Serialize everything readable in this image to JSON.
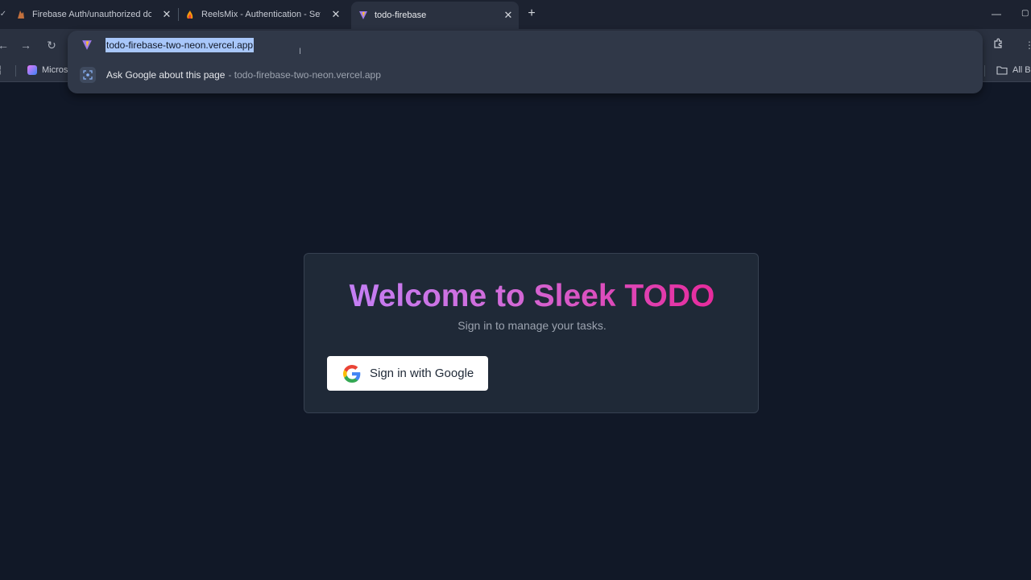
{
  "tabs": [
    {
      "title": "Firebase Auth/unauthorized do",
      "icon": "firebase-icon",
      "active": false
    },
    {
      "title": "ReelsMix - Authentication - Set",
      "icon": "firebase-icon",
      "active": false
    },
    {
      "title": "todo-firebase",
      "icon": "vite-icon",
      "active": true
    }
  ],
  "tab_close_glyph": "✕",
  "new_tab_glyph": "+",
  "omnibox": {
    "url": "todo-firebase-two-neon.vercel.app",
    "suggestion_text": "Ask Google about this page",
    "suggestion_sub": "- todo-firebase-two-neon.vercel.app"
  },
  "bookmarks": {
    "first": "Micros",
    "all_bookmarks": "All Bo"
  },
  "page": {
    "title": "Welcome to Sleek TODO",
    "subtitle": "Sign in to manage your tasks.",
    "signin_label": "Sign in with Google"
  },
  "colors": {
    "background": "#111827",
    "card": "#1f2937",
    "gradient_start": "#c084fc",
    "gradient_end": "#ec1d8f",
    "url_highlight": "#a8c7fa"
  }
}
